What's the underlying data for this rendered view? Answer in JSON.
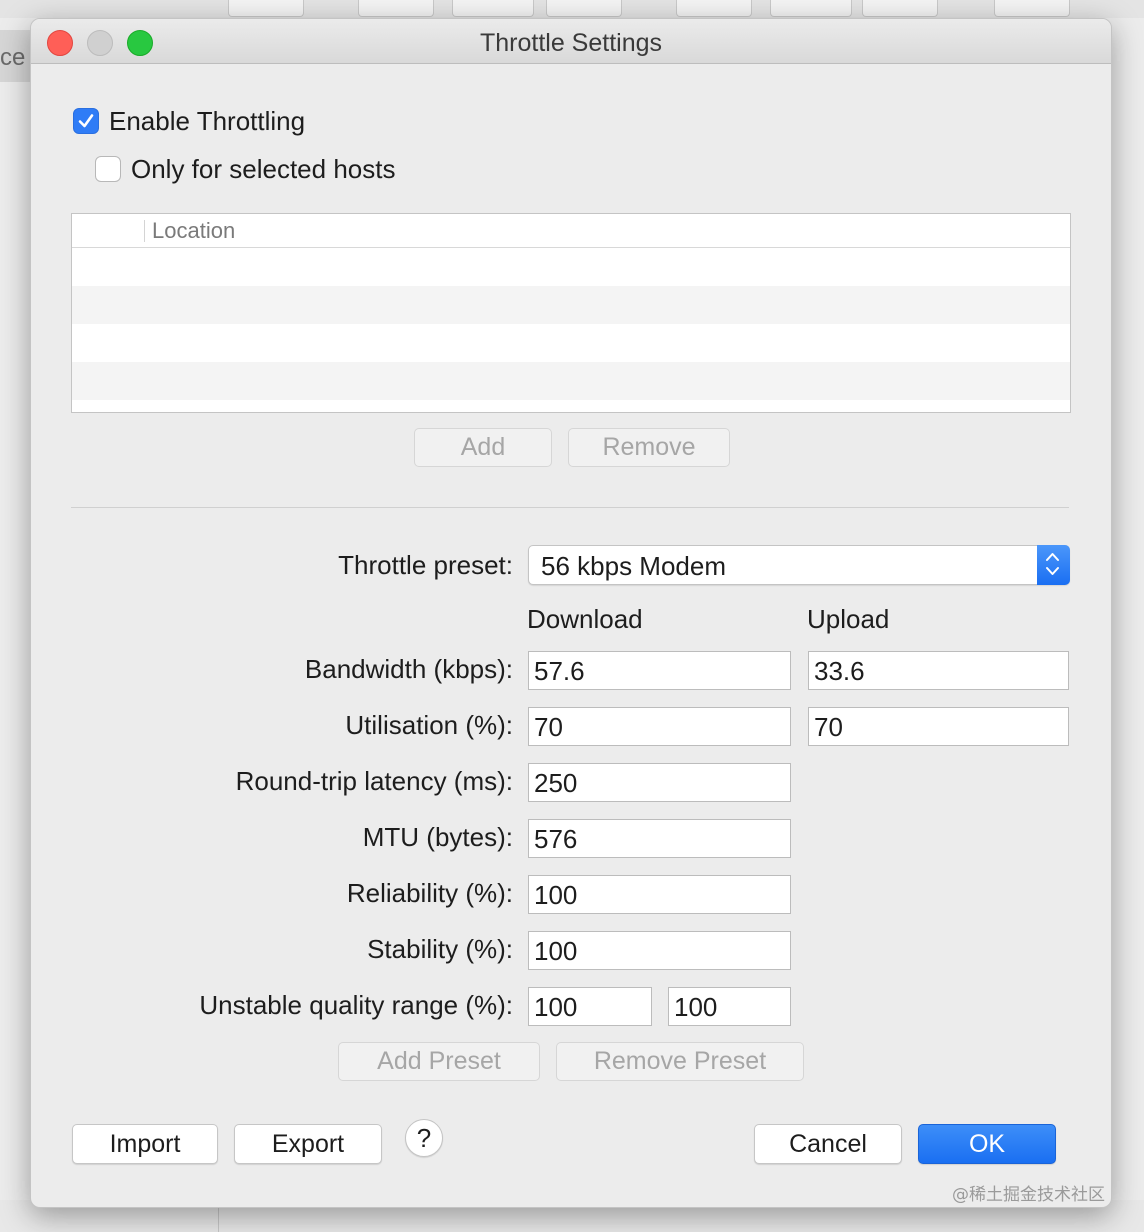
{
  "window": {
    "title": "Throttle Settings"
  },
  "background": {
    "side_text": "ce"
  },
  "throttling": {
    "enable_label": "Enable Throttling",
    "enable_checked": true,
    "selected_hosts_label": "Only for selected hosts",
    "selected_hosts_checked": false
  },
  "hosts_table": {
    "columns": [
      "",
      "Location"
    ],
    "rows": []
  },
  "hosts_buttons": {
    "add": "Add",
    "remove": "Remove"
  },
  "preset": {
    "label": "Throttle preset:",
    "value": "56 kbps Modem"
  },
  "columns": {
    "download": "Download",
    "upload": "Upload"
  },
  "settings": {
    "bandwidth": {
      "label": "Bandwidth (kbps):",
      "download": "57.6",
      "upload": "33.6"
    },
    "utilisation": {
      "label": "Utilisation (%):",
      "download": "70",
      "upload": "70"
    },
    "latency": {
      "label": "Round-trip latency (ms):",
      "value": "250"
    },
    "mtu": {
      "label": "MTU (bytes):",
      "value": "576"
    },
    "reliability": {
      "label": "Reliability (%):",
      "value": "100"
    },
    "stability": {
      "label": "Stability (%):",
      "value": "100"
    },
    "unstable_quality": {
      "label": "Unstable quality range (%):",
      "min": "100",
      "max": "100"
    }
  },
  "preset_buttons": {
    "add": "Add Preset",
    "remove": "Remove Preset"
  },
  "footer": {
    "import": "Import",
    "export": "Export",
    "help": "?",
    "cancel": "Cancel",
    "ok": "OK"
  },
  "watermark": "@稀土掘金技术社区",
  "colors": {
    "accent": "#2f7cf6",
    "close": "#ff5f57",
    "maximize": "#28c840"
  }
}
